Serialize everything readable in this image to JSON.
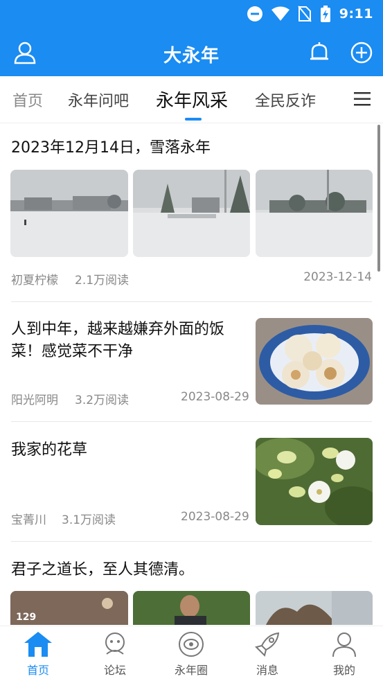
{
  "status_bar": {
    "time": "9:11"
  },
  "header": {
    "title": "大永年"
  },
  "tabs": [
    {
      "label": "首页"
    },
    {
      "label": "永年问吧"
    },
    {
      "label": "永年风采"
    },
    {
      "label": "全民反诈"
    }
  ],
  "articles": [
    {
      "title": "2023年12月14日，雪落永年",
      "author": "初夏柠檬",
      "reads": "2.1万阅读",
      "date": "2023-12-14"
    },
    {
      "title": "人到中年，越来越嫌弃外面的饭菜！感觉菜不干净",
      "author": "阳光阿明",
      "reads": "3.2万阅读",
      "date": "2023-08-29"
    },
    {
      "title": "我家的花草",
      "author": "宝菁川",
      "reads": "3.1万阅读",
      "date": "2023-08-29"
    },
    {
      "title": "君子之道长，至人其德清。",
      "thumb_text": "129"
    }
  ],
  "bottom_nav": [
    {
      "label": "首页"
    },
    {
      "label": "论坛"
    },
    {
      "label": "永年圈"
    },
    {
      "label": "消息"
    },
    {
      "label": "我的"
    }
  ],
  "colors": {
    "brand": "#1a8cf2",
    "meta": "#888888"
  }
}
